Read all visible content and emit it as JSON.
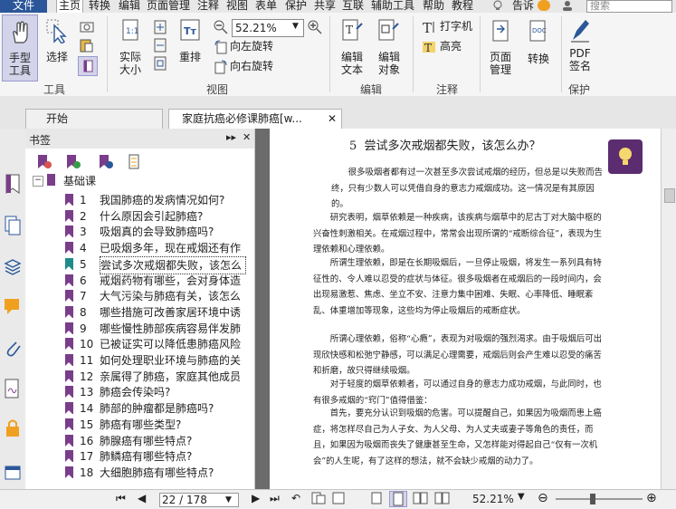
{
  "menu": {
    "file": "文件",
    "items": [
      "主页",
      "转换",
      "编辑",
      "页面管理",
      "注释",
      "视图",
      "表单",
      "保护",
      "共享",
      "互联",
      "辅助工具",
      "帮助",
      "教程"
    ],
    "active": "主页",
    "right_text": "告诉",
    "search_placeholder": "搜索"
  },
  "ribbon": {
    "hand_tool": "手型\n工具",
    "select": "选择",
    "actual_size": "实际\n大小",
    "reflow": "重排",
    "zoom_value": "52.21%",
    "rotate_left": "向左旋转",
    "rotate_right": "向右旋转",
    "edit_text": "编辑\n文本",
    "edit_object": "编辑\n对象",
    "typewriter": "打字机",
    "highlight": "高亮",
    "page_manage": "页面\n管理",
    "convert": "转换",
    "pdf_sign": "PDF\n签名",
    "groups": {
      "tools": "工具",
      "view": "视图",
      "edit": "编辑",
      "annotate": "注释",
      "protect": "保护"
    }
  },
  "tabs": [
    {
      "label": "开始",
      "active": false
    },
    {
      "label": "家庭抗癌必修课肺癌[w...",
      "active": true
    }
  ],
  "bookmarks": {
    "title": "书签",
    "root": "基础课",
    "items": [
      {
        "num": "1",
        "text": "我国肺癌的发病情况如何?"
      },
      {
        "num": "2",
        "text": "什么原因会引起肺癌?"
      },
      {
        "num": "3",
        "text": "吸烟真的会导致肺癌吗?"
      },
      {
        "num": "4",
        "text": "已吸烟多年，现在戒烟还有作"
      },
      {
        "num": "5",
        "text": "尝试多次戒烟都失败，该怎么",
        "selected": true
      },
      {
        "num": "6",
        "text": "戒烟药物有哪些，会对身体造"
      },
      {
        "num": "7",
        "text": "大气污染与肺癌有关，该怎么"
      },
      {
        "num": "8",
        "text": "哪些措施可改善家居环境中诱"
      },
      {
        "num": "9",
        "text": "哪些慢性肺部疾病容易伴发肺"
      },
      {
        "num": "10",
        "text": "已被证实可以降低患肺癌风险"
      },
      {
        "num": "11",
        "text": "如何处理职业环境与肺癌的关"
      },
      {
        "num": "12",
        "text": "亲属得了肺癌，家庭其他成员"
      },
      {
        "num": "13",
        "text": "肺癌会传染吗?"
      },
      {
        "num": "14",
        "text": "肺部的肿瘤都是肺癌吗?"
      },
      {
        "num": "15",
        "text": "肺癌有哪些类型?"
      },
      {
        "num": "16",
        "text": "肺腺癌有哪些特点?"
      },
      {
        "num": "17",
        "text": "肺鳞癌有哪些特点?"
      },
      {
        "num": "18",
        "text": "大细胞肺癌有哪些特点?"
      }
    ]
  },
  "document": {
    "title_num": "5",
    "title": "尝试多次戒烟都失败，该怎么办？",
    "paragraphs": [
      "很多吸烟者都有过一次甚至多次尝试戒烟的经历，但总是以失败而告终，只有少数人可以凭借自身的意志力戒烟成功。这一情况是有其原因的。",
      "研究表明，烟草依赖是一种疾病，该疾病与烟草中的尼古丁对大脑中枢的兴奋性刺激相关。在戒烟过程中，常常会出现所谓的“戒断综合征”，表现为生理依赖和心理依赖。",
      "所谓生理依赖，即是在长期吸烟后，一旦停止吸烟，将发生一系列具有特征性的、令人难以忍受的症状与体征。很多吸烟者在戒烟后的一段时间内，会出现易激惹、焦虑、坐立不安、注意力集中困难、失眠、心率降低、睡眠紊乱、体重增加等现象，这些均为停止吸烟后的戒断症状。",
      "所谓心理依赖，俗称“心瘾”，表现为对吸烟的强烈渴求。由于吸烟后可出现欣快感和松弛宁静感，可以满足心理需要，戒烟后则会产生难以忍受的痛苦和折磨，故只得继续吸烟。",
      "对于轻度的烟草依赖者，可以通过自身的意志力成功戒烟，与此同时，也有很多戒烟的“窍门”值得借鉴：",
      "首先，要充分认识到吸烟的危害。可以提醒自己，如果因为吸烟而患上癌症，将怎样尽自己为人子女、为人父母、为人丈夫或妻子等角色的责任，而且，如果因为吸烟而丧失了健康甚至生命，又怎样能对得起自己“仅有一次机会”的人生呢，有了这样的想法，就不会缺少戒烟的动力了。"
    ]
  },
  "status": {
    "page": "22 / 178",
    "zoom": "52.21%"
  }
}
